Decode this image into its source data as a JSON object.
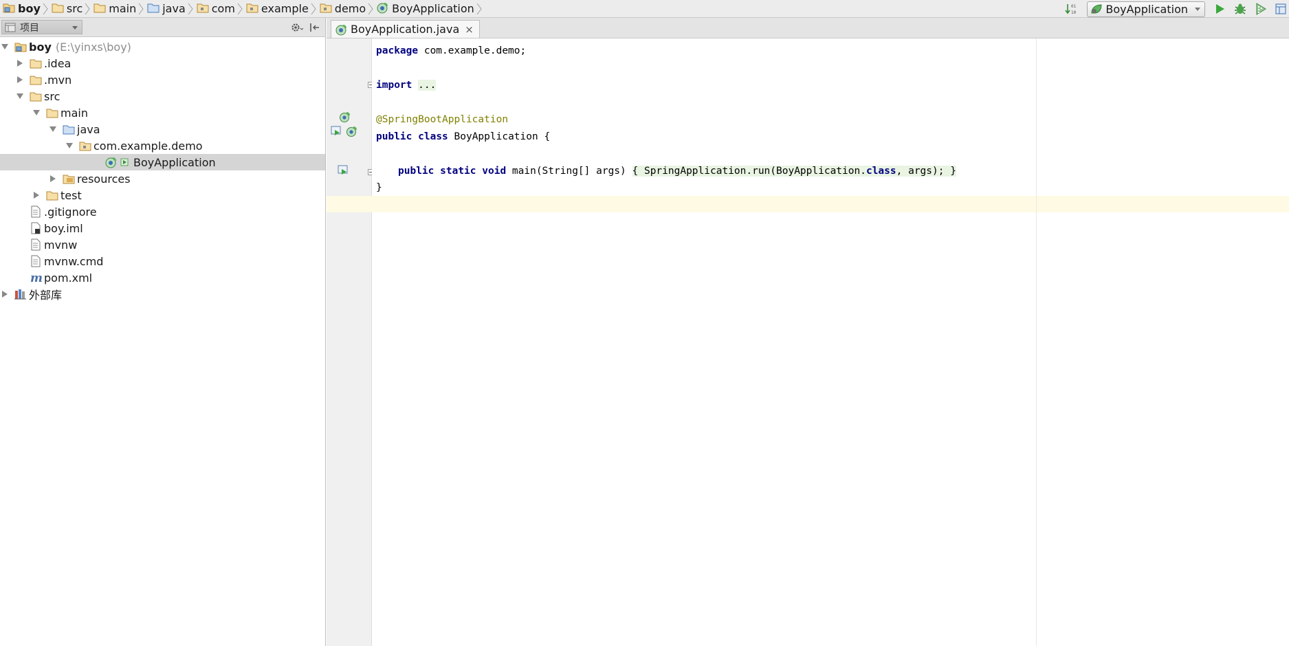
{
  "breadcrumbs": [
    {
      "label": "boy",
      "icon": "project-folder-icon"
    },
    {
      "label": "src",
      "icon": "folder-icon"
    },
    {
      "label": "main",
      "icon": "folder-icon"
    },
    {
      "label": "java",
      "icon": "source-folder-icon"
    },
    {
      "label": "com",
      "icon": "package-icon"
    },
    {
      "label": "example",
      "icon": "package-icon"
    },
    {
      "label": "demo",
      "icon": "package-icon"
    },
    {
      "label": "BoyApplication",
      "icon": "spring-boot-class-icon"
    }
  ],
  "toolbar": {
    "run_config": "BoyApplication",
    "buttons": [
      "sort-icon",
      "run-icon",
      "debug-icon",
      "coverage-icon",
      "layout-icon"
    ]
  },
  "project_panel": {
    "view_label": "项目",
    "tree": [
      {
        "name": "boy",
        "hint": "(E:\\yinxs\\boy)",
        "level": 0,
        "expanded": true,
        "icon": "project-folder-icon"
      },
      {
        "name": ".idea",
        "level": 1,
        "expanded": false,
        "icon": "folder-icon"
      },
      {
        "name": ".mvn",
        "level": 1,
        "expanded": false,
        "icon": "folder-icon"
      },
      {
        "name": "src",
        "level": 1,
        "expanded": true,
        "icon": "folder-icon"
      },
      {
        "name": "main",
        "level": 2,
        "expanded": true,
        "icon": "folder-icon"
      },
      {
        "name": "java",
        "level": 3,
        "expanded": true,
        "icon": "source-folder-icon"
      },
      {
        "name": "com.example.demo",
        "level": 4,
        "expanded": true,
        "icon": "package-icon"
      },
      {
        "name": "BoyApplication",
        "level": 5,
        "selected": true,
        "icon": "spring-boot-class-icon"
      },
      {
        "name": "resources",
        "level": 3,
        "expanded": false,
        "icon": "resources-folder-icon"
      },
      {
        "name": "test",
        "level": 2,
        "expanded": false,
        "icon": "folder-icon"
      },
      {
        "name": ".gitignore",
        "level": 1,
        "icon": "file-icon"
      },
      {
        "name": "boy.iml",
        "level": 1,
        "icon": "iml-file-icon"
      },
      {
        "name": "mvnw",
        "level": 1,
        "icon": "file-icon"
      },
      {
        "name": "mvnw.cmd",
        "level": 1,
        "icon": "file-icon"
      },
      {
        "name": "pom.xml",
        "level": 1,
        "icon": "maven-file-icon"
      },
      {
        "name": "外部库",
        "level": 0,
        "expanded": false,
        "icon": "library-icon"
      }
    ]
  },
  "editor": {
    "tab": {
      "label": "BoyApplication.java",
      "close": "×"
    },
    "code": {
      "l1_kw": "package",
      "l1_rest": " com.example.demo;",
      "l3_kw": "import",
      "l3_fold": "...",
      "l5_ann": "@SpringBootApplication",
      "l6_kw1": "public",
      "l6_kw2": "class",
      "l6_rest": " BoyApplication {",
      "l8_kw1": "public",
      "l8_kw2": "static",
      "l8_kw3": "void",
      "l8_sig": " main(String[] args) ",
      "l8_body1": "{ SpringApplication.run(BoyApplication.",
      "l8_kw4": "class",
      "l8_body2": ", args); }",
      "l9": "}"
    }
  },
  "colors": {
    "keyword": "#000080",
    "annotation": "#808000",
    "caret_line": "#fffae3",
    "selection": "#d5d5d5",
    "folder": "#c59a4b",
    "run_green": "#3aa83a"
  }
}
